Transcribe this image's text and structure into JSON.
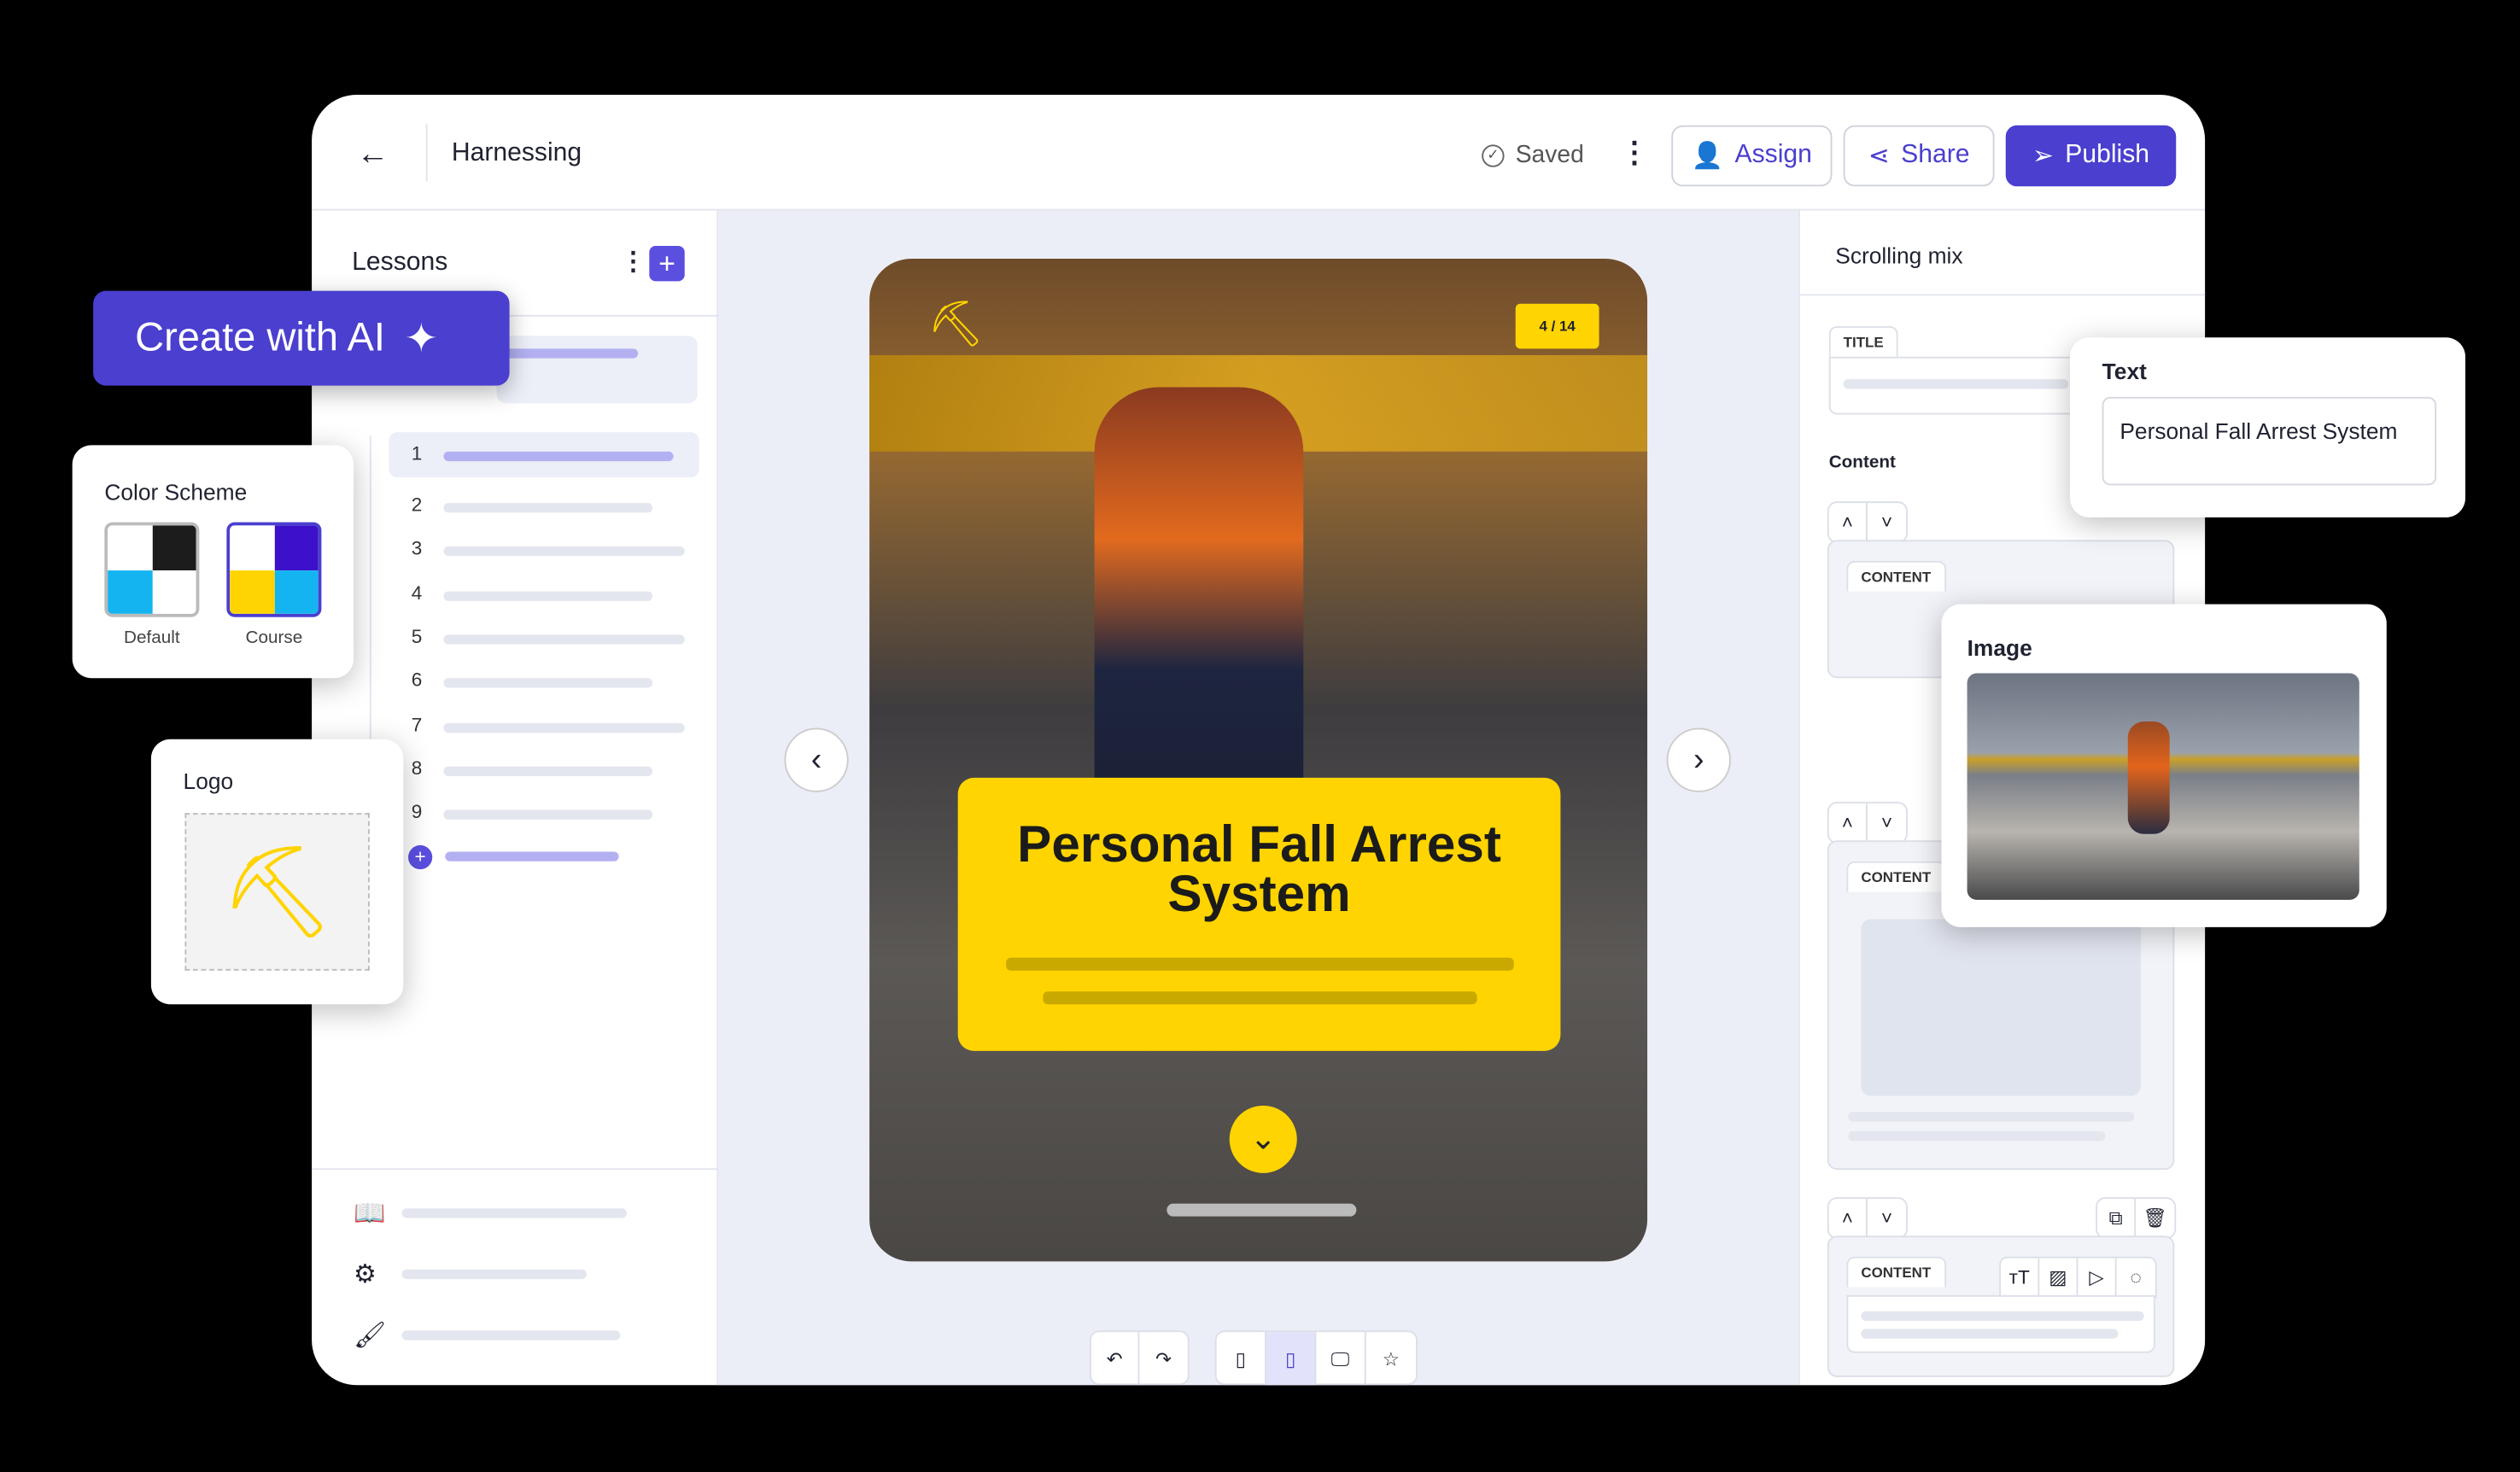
{
  "header": {
    "title": "Harnessing",
    "status": "Saved",
    "assign": "Assign",
    "share": "Share",
    "publish": "Publish",
    "accent": "#4a3fcf"
  },
  "lessons": {
    "title": "Lessons",
    "items": [
      "1",
      "2",
      "3",
      "4",
      "5",
      "6",
      "7",
      "8",
      "9"
    ]
  },
  "ai_button": "Create with AI",
  "color_scheme": {
    "title": "Color Scheme",
    "options": [
      {
        "label": "Default",
        "colors": [
          "#ffffff",
          "#1c1c1c",
          "#14b4f0",
          "#ffffff"
        ]
      },
      {
        "label": "Course",
        "colors": [
          "#ffffff",
          "#3d10c9",
          "#ffd400",
          "#14b4f0"
        ]
      }
    ]
  },
  "logo": {
    "title": "Logo"
  },
  "slide": {
    "counter": "4 / 14",
    "title": "Personal Fall Arrest System",
    "yellow": "#ffd400"
  },
  "right_panel": {
    "title": "Scrolling mix",
    "title_tag": "TITLE",
    "content_label": "Content",
    "content_tag": "CONTENT"
  },
  "text_card": {
    "title": "Text",
    "value": "Personal Fall Arrest System"
  },
  "image_card": {
    "title": "Image"
  }
}
